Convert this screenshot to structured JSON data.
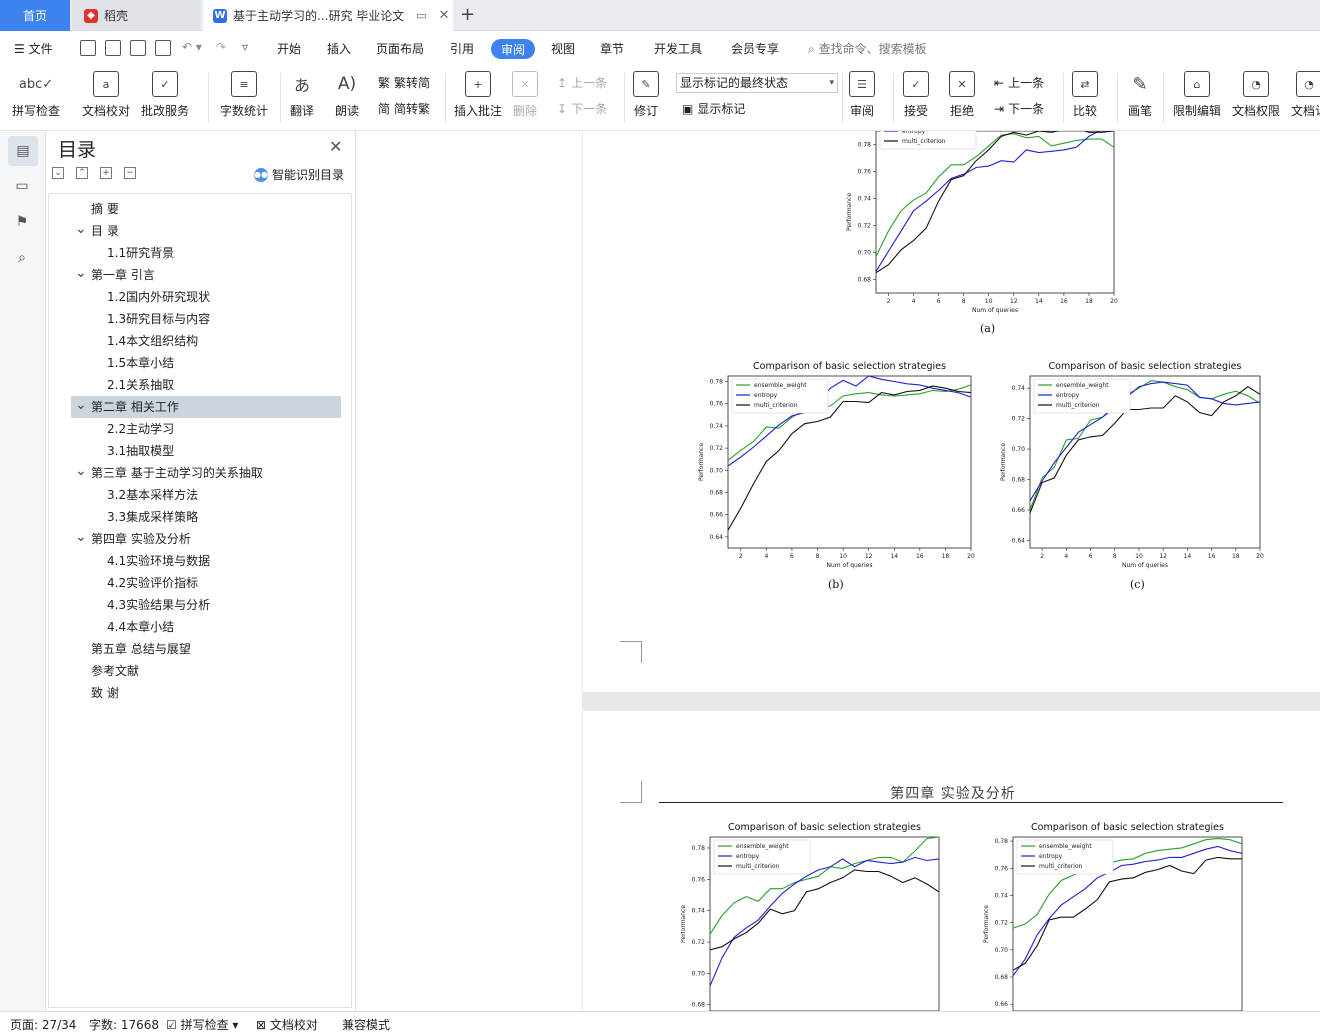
{
  "tabs": {
    "home": "首页",
    "draw": "稻壳",
    "doc": "基于主动学习的...研究 毕业论文"
  },
  "menu": {
    "file": "文件",
    "items": [
      "开始",
      "插入",
      "页面布局",
      "引用",
      "审阅",
      "视图",
      "章节",
      "开发工具",
      "会员专享"
    ],
    "active": "审阅",
    "search": "查找命令、搜索模板"
  },
  "ribbon": {
    "spell": "拼写检查",
    "proof": "文档校对",
    "review_service": "批改服务",
    "word_count": "字数统计",
    "translate": "翻译",
    "read": "朗读",
    "trad_to_simp": "繁转简",
    "simp_to_trad": "简转繁",
    "insert_comment": "插入批注",
    "delete": "删除",
    "prev_comment": "上一条",
    "next_comment": "下一条",
    "revise": "修订",
    "markup_state": "显示标记的最终状态",
    "show_markup": "显示标记",
    "review": "审阅",
    "accept": "接受",
    "reject": "拒绝",
    "prev_change": "上一条",
    "next_change": "下一条",
    "compare": "比较",
    "pen": "画笔",
    "restrict": "限制编辑",
    "permission": "文档权限",
    "doc_cert": "文档认"
  },
  "toc": {
    "title": "目录",
    "smart": "智能识别目录",
    "items": [
      {
        "label": "摘  要",
        "level": 1,
        "chevron": false
      },
      {
        "label": "目  录",
        "level": 1,
        "chevron": true
      },
      {
        "label": "1.1研究背景",
        "level": 2,
        "chevron": false
      },
      {
        "label": "第一章  引言",
        "level": 1,
        "chevron": true
      },
      {
        "label": "1.2国内外研究现状",
        "level": 2,
        "chevron": false
      },
      {
        "label": "1.3研究目标与内容",
        "level": 2,
        "chevron": false
      },
      {
        "label": "1.4本文组织结构",
        "level": 2,
        "chevron": false
      },
      {
        "label": "1.5本章小结",
        "level": 2,
        "chevron": false
      },
      {
        "label": "2.1关系抽取",
        "level": 2,
        "chevron": false
      },
      {
        "label": "第二章  相关工作",
        "level": 1,
        "chevron": true,
        "selected": true
      },
      {
        "label": "2.2主动学习",
        "level": 2,
        "chevron": false
      },
      {
        "label": "3.1抽取模型",
        "level": 2,
        "chevron": false
      },
      {
        "label": "第三章  基于主动学习的关系抽取",
        "level": 1,
        "chevron": true
      },
      {
        "label": "3.2基本采样方法",
        "level": 2,
        "chevron": false
      },
      {
        "label": "3.3集成采样策略",
        "level": 2,
        "chevron": false
      },
      {
        "label": "第四章  实验及分析",
        "level": 1,
        "chevron": true
      },
      {
        "label": "4.1实验环境与数据",
        "level": 2,
        "chevron": false
      },
      {
        "label": "4.2实验评价指标",
        "level": 2,
        "chevron": false
      },
      {
        "label": "4.3实验结果与分析",
        "level": 2,
        "chevron": false
      },
      {
        "label": "4.4本章小结",
        "level": 2,
        "chevron": false
      },
      {
        "label": "第五章  总结与展望",
        "level": 1,
        "chevron": false
      },
      {
        "label": "参考文献",
        "level": 1,
        "chevron": false
      },
      {
        "label": "致  谢",
        "level": 1,
        "chevron": false
      }
    ]
  },
  "document": {
    "caption_a": "(a)",
    "caption_b": "(b)",
    "caption_c": "(c)",
    "chapter_header": "第四章    实验及分析"
  },
  "status": {
    "page": "页面: 27/34",
    "words": "字数: 17668",
    "spell": "拼写检查",
    "proof": "文档校对",
    "compat": "兼容模式"
  },
  "colors": {
    "accent": "#3c83f0",
    "ensemble_weight": "#2ca02c",
    "entropy": "#1f1fd6",
    "multi_criterion": "#111111"
  },
  "chart_data": [
    {
      "type": "line",
      "id": "a",
      "title": "",
      "xlabel": "Num of queries",
      "ylabel": "Performance",
      "xlim": [
        1,
        20
      ],
      "ylim": [
        0.67,
        0.79
      ],
      "xticks": [
        2,
        4,
        6,
        8,
        10,
        12,
        14,
        16,
        18,
        20
      ],
      "yticks": [
        0.68,
        0.7,
        0.72,
        0.74,
        0.76,
        0.78
      ],
      "legend": [
        "entropy",
        "multi_criterion"
      ],
      "x": [
        1,
        2,
        3,
        4,
        5,
        6,
        7,
        8,
        9,
        10,
        11,
        12,
        13,
        14,
        15,
        16,
        17,
        18,
        19,
        20
      ],
      "series": [
        {
          "name": "ensemble_weight",
          "color": "#2ca02c",
          "values": [
            0.697,
            0.716,
            0.731,
            0.739,
            0.744,
            0.756,
            0.765,
            0.765,
            0.771,
            0.779,
            0.787,
            0.788,
            0.785,
            0.786,
            0.779,
            0.781,
            0.783,
            0.784,
            0.784,
            0.778
          ]
        },
        {
          "name": "entropy",
          "color": "#1f1fd6",
          "values": [
            0.686,
            0.701,
            0.716,
            0.731,
            0.738,
            0.746,
            0.755,
            0.758,
            0.763,
            0.764,
            0.768,
            0.767,
            0.776,
            0.774,
            0.775,
            0.776,
            0.778,
            0.786,
            0.791,
            0.793
          ]
        },
        {
          "name": "multi_criterion",
          "color": "#111111",
          "values": [
            0.685,
            0.691,
            0.702,
            0.709,
            0.718,
            0.738,
            0.754,
            0.757,
            0.768,
            0.776,
            0.786,
            0.789,
            0.787,
            0.79,
            0.789,
            0.791,
            0.792,
            0.789,
            0.789,
            0.79
          ]
        }
      ]
    },
    {
      "type": "line",
      "id": "b",
      "title": "Comparison of basic selection strategies",
      "xlabel": "Num of queries",
      "ylabel": "Performance",
      "xlim": [
        1,
        20
      ],
      "ylim": [
        0.63,
        0.785
      ],
      "xticks": [
        2,
        4,
        6,
        8,
        10,
        12,
        14,
        16,
        18,
        20
      ],
      "yticks": [
        0.64,
        0.66,
        0.68,
        0.7,
        0.72,
        0.74,
        0.76,
        0.78
      ],
      "legend": [
        "ensemble_weight",
        "entropy",
        "multi_criterion"
      ],
      "x": [
        1,
        2,
        3,
        4,
        5,
        6,
        7,
        8,
        9,
        10,
        11,
        12,
        13,
        14,
        15,
        16,
        17,
        18,
        19,
        20
      ],
      "series": [
        {
          "name": "ensemble_weight",
          "color": "#2ca02c",
          "values": [
            0.709,
            0.718,
            0.726,
            0.739,
            0.738,
            0.748,
            0.754,
            0.757,
            0.758,
            0.767,
            0.769,
            0.77,
            0.768,
            0.767,
            0.768,
            0.769,
            0.772,
            0.771,
            0.773,
            0.777
          ]
        },
        {
          "name": "entropy",
          "color": "#1f1fd6",
          "values": [
            0.704,
            0.712,
            0.721,
            0.731,
            0.741,
            0.749,
            0.752,
            0.76,
            0.774,
            0.781,
            0.776,
            0.785,
            0.782,
            0.78,
            0.778,
            0.777,
            0.774,
            0.772,
            0.77,
            0.766
          ]
        },
        {
          "name": "multi_criterion",
          "color": "#111111",
          "values": [
            0.646,
            0.666,
            0.688,
            0.708,
            0.718,
            0.733,
            0.742,
            0.744,
            0.748,
            0.762,
            0.762,
            0.761,
            0.77,
            0.768,
            0.771,
            0.772,
            0.776,
            0.774,
            0.771,
            0.77
          ]
        }
      ]
    },
    {
      "type": "line",
      "id": "c",
      "title": "Comparison of basic selection strategies",
      "xlabel": "Num of queries",
      "ylabel": "Performance",
      "xlim": [
        1,
        20
      ],
      "ylim": [
        0.635,
        0.748
      ],
      "xticks": [
        2,
        4,
        6,
        8,
        10,
        12,
        14,
        16,
        18,
        20
      ],
      "yticks": [
        0.64,
        0.66,
        0.68,
        0.7,
        0.72,
        0.74
      ],
      "legend": [
        "ensemble_weight",
        "entropy",
        "multi_criterion"
      ],
      "x": [
        1,
        2,
        3,
        4,
        5,
        6,
        7,
        8,
        9,
        10,
        11,
        12,
        13,
        14,
        15,
        16,
        17,
        18,
        19,
        20
      ],
      "series": [
        {
          "name": "ensemble_weight",
          "color": "#2ca02c",
          "values": [
            0.66,
            0.681,
            0.688,
            0.706,
            0.707,
            0.719,
            0.721,
            0.729,
            0.736,
            0.74,
            0.745,
            0.744,
            0.741,
            0.739,
            0.734,
            0.733,
            0.736,
            0.738,
            0.735,
            0.73
          ]
        },
        {
          "name": "entropy",
          "color": "#1f1fd6",
          "values": [
            0.666,
            0.679,
            0.691,
            0.701,
            0.711,
            0.716,
            0.721,
            0.727,
            0.734,
            0.741,
            0.743,
            0.744,
            0.743,
            0.742,
            0.734,
            0.733,
            0.73,
            0.729,
            0.73,
            0.731
          ]
        },
        {
          "name": "multi_criterion",
          "color": "#111111",
          "values": [
            0.658,
            0.678,
            0.681,
            0.696,
            0.706,
            0.708,
            0.709,
            0.717,
            0.726,
            0.726,
            0.727,
            0.727,
            0.735,
            0.731,
            0.724,
            0.722,
            0.731,
            0.735,
            0.741,
            0.736
          ]
        }
      ]
    },
    {
      "type": "line",
      "id": "d",
      "title": "Comparison of basic selection strategies",
      "xlabel": "",
      "ylabel": "Performance",
      "xlim": [
        1,
        20
      ],
      "ylim": [
        0.676,
        0.787
      ],
      "xticks": [],
      "yticks": [
        0.68,
        0.7,
        0.72,
        0.74,
        0.76,
        0.78
      ],
      "legend": [
        "ensemble_weight",
        "entropy",
        "multi_criterion"
      ],
      "x": [
        1,
        2,
        3,
        4,
        5,
        6,
        7,
        8,
        9,
        10,
        11,
        12,
        13,
        14,
        15,
        16,
        17,
        18,
        19,
        20
      ],
      "series": [
        {
          "name": "ensemble_weight",
          "color": "#2ca02c",
          "values": [
            0.725,
            0.737,
            0.745,
            0.749,
            0.746,
            0.754,
            0.754,
            0.758,
            0.76,
            0.762,
            0.768,
            0.767,
            0.77,
            0.772,
            0.774,
            0.774,
            0.771,
            0.778,
            0.786,
            0.787
          ]
        },
        {
          "name": "entropy",
          "color": "#1f1fd6",
          "values": [
            0.692,
            0.71,
            0.723,
            0.729,
            0.734,
            0.743,
            0.751,
            0.757,
            0.762,
            0.766,
            0.768,
            0.773,
            0.768,
            0.772,
            0.771,
            0.77,
            0.771,
            0.774,
            0.772,
            0.773
          ]
        },
        {
          "name": "multi_criterion",
          "color": "#111111",
          "values": [
            0.715,
            0.717,
            0.722,
            0.726,
            0.732,
            0.741,
            0.738,
            0.74,
            0.752,
            0.754,
            0.758,
            0.761,
            0.766,
            0.765,
            0.765,
            0.762,
            0.758,
            0.761,
            0.757,
            0.752
          ]
        }
      ]
    },
    {
      "type": "line",
      "id": "e",
      "title": "Comparison of basic selection strategies",
      "xlabel": "",
      "ylabel": "Performance",
      "xlim": [
        1,
        20
      ],
      "ylim": [
        0.655,
        0.783
      ],
      "xticks": [],
      "yticks": [
        0.66,
        0.68,
        0.7,
        0.72,
        0.74,
        0.76,
        0.78
      ],
      "legend": [
        "ensemble_weight",
        "entropy",
        "multi_criterion"
      ],
      "x": [
        1,
        2,
        3,
        4,
        5,
        6,
        7,
        8,
        9,
        10,
        11,
        12,
        13,
        14,
        15,
        16,
        17,
        18,
        19,
        20
      ],
      "series": [
        {
          "name": "ensemble_weight",
          "color": "#2ca02c",
          "values": [
            0.716,
            0.719,
            0.726,
            0.741,
            0.751,
            0.755,
            0.759,
            0.761,
            0.764,
            0.766,
            0.767,
            0.771,
            0.773,
            0.774,
            0.775,
            0.778,
            0.781,
            0.782,
            0.781,
            0.778
          ]
        },
        {
          "name": "entropy",
          "color": "#1f1fd6",
          "values": [
            0.681,
            0.693,
            0.711,
            0.723,
            0.733,
            0.739,
            0.745,
            0.753,
            0.757,
            0.762,
            0.763,
            0.765,
            0.766,
            0.768,
            0.768,
            0.771,
            0.774,
            0.776,
            0.773,
            0.771
          ]
        },
        {
          "name": "multi_criterion",
          "color": "#111111",
          "values": [
            0.685,
            0.69,
            0.703,
            0.722,
            0.724,
            0.724,
            0.73,
            0.737,
            0.75,
            0.752,
            0.753,
            0.757,
            0.759,
            0.762,
            0.758,
            0.756,
            0.766,
            0.768,
            0.767,
            0.767
          ]
        }
      ]
    }
  ]
}
